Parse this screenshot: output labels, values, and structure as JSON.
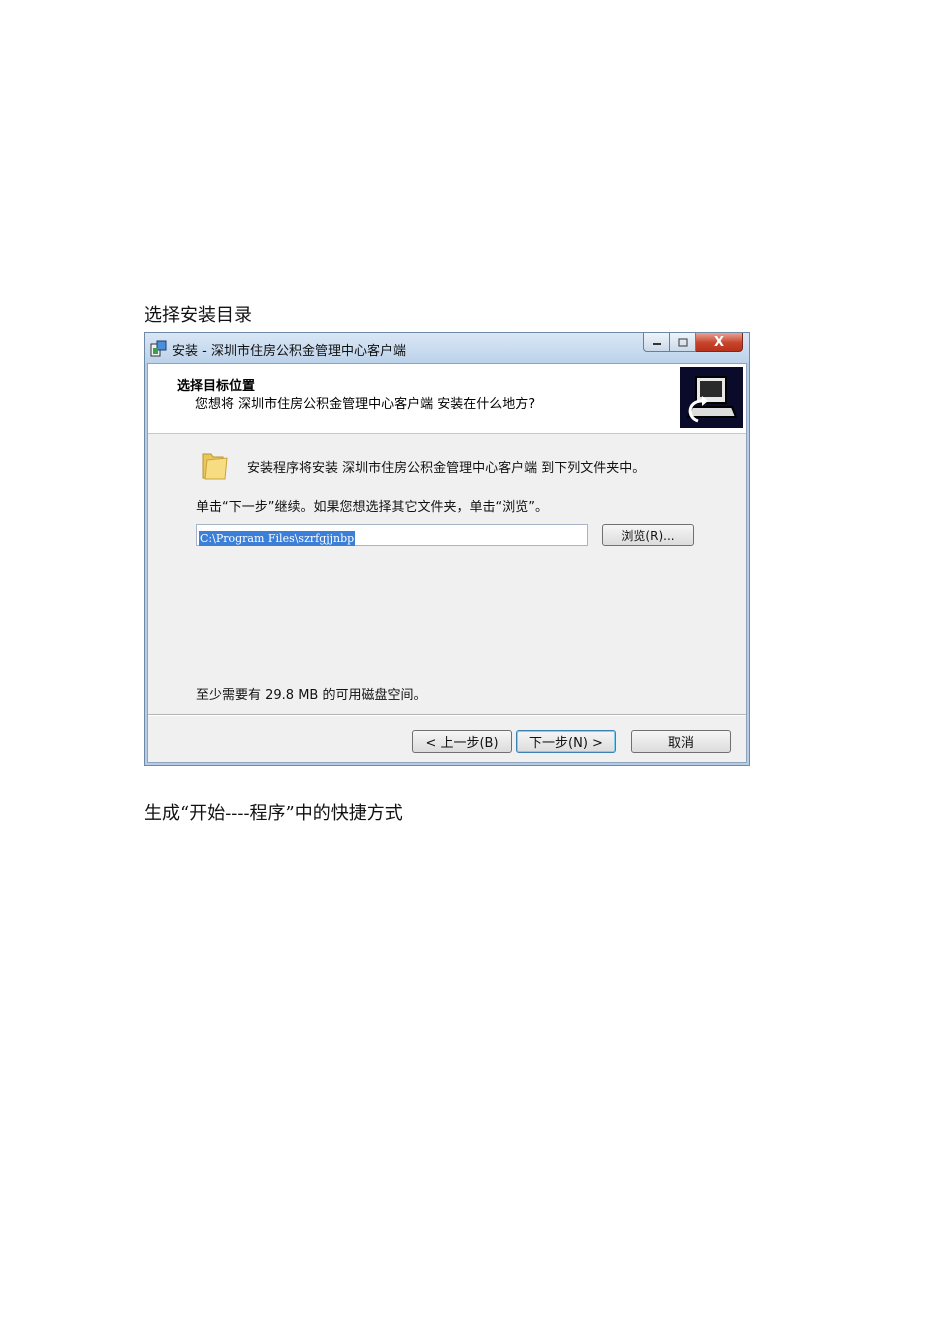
{
  "captions": {
    "top": "选择安装目录",
    "bottom": "生成“开始----程序”中的快捷方式"
  },
  "window": {
    "title": "安装 - 深圳市住房公积金管理中心客户端",
    "close_glyph": "X"
  },
  "header": {
    "title": "选择目标位置",
    "subtitle": "您想将 深圳市住房公积金管理中心客户端 安装在什么地方?"
  },
  "body": {
    "line1": "安装程序将安装 深圳市住房公积金管理中心客户端 到下列文件夹中。",
    "line2": "单击“下一步”继续。如果您想选择其它文件夹，单击“浏览”。",
    "path_value": "C:\\Program Files\\szrfgjjnbp",
    "browse_label": "浏览(R)...",
    "disk_space": "至少需要有 29.8 MB 的可用磁盘空间。"
  },
  "footer": {
    "back_label": "< 上一步(B)",
    "next_label": "下一步(N) >",
    "cancel_label": "取消"
  },
  "colors": {
    "selection": "#3c7fd9",
    "close_button": "#c7432a",
    "title_bar": "#bcd2ea"
  }
}
